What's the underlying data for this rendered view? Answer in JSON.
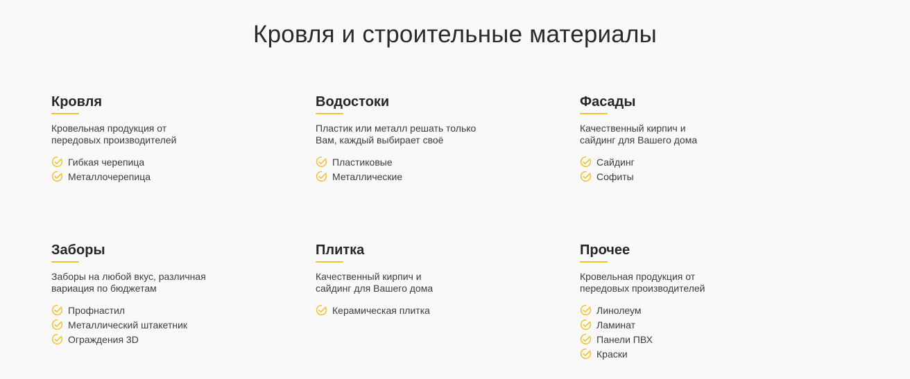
{
  "page": {
    "title": "Кровля и строительные материалы"
  },
  "colors": {
    "accent": "#f2c12e",
    "background": "#f9f9fa",
    "text": "#2a2a2a"
  },
  "icons": {
    "item_marker": "check-circle-icon"
  },
  "categories": [
    {
      "title": "Кровля",
      "desc_line1": "Кровельная продукция от",
      "desc_line2": "передовых производителей",
      "items": [
        "Гибкая черепица",
        "Металлочерепица"
      ]
    },
    {
      "title": "Водостоки",
      "desc_line1": "Пластик или металл решать только",
      "desc_line2": "Вам, каждый выбирает своё",
      "items": [
        "Пластиковые",
        "Металлические"
      ]
    },
    {
      "title": "Фасады",
      "desc_line1": "Качественный кирпич и",
      "desc_line2": "сайдинг для Вашего дома",
      "items": [
        "Сайдинг",
        "Софиты"
      ]
    },
    {
      "title": "Заборы",
      "desc_line1": "Заборы на любой вкус, различная",
      "desc_line2": "вариация по бюджетам",
      "items": [
        "Профнастил",
        "Металлический штакетник",
        "Ограждения 3D"
      ]
    },
    {
      "title": "Плитка",
      "desc_line1": "Качественный кирпич и",
      "desc_line2": "сайдинг для Вашего дома",
      "items": [
        "Керамическая плитка"
      ]
    },
    {
      "title": "Прочее",
      "desc_line1": "Кровельная продукция от",
      "desc_line2": "передовых производителей",
      "items": [
        "Линолеум",
        "Ламинат",
        "Панели ПВХ",
        "Краски"
      ]
    }
  ]
}
